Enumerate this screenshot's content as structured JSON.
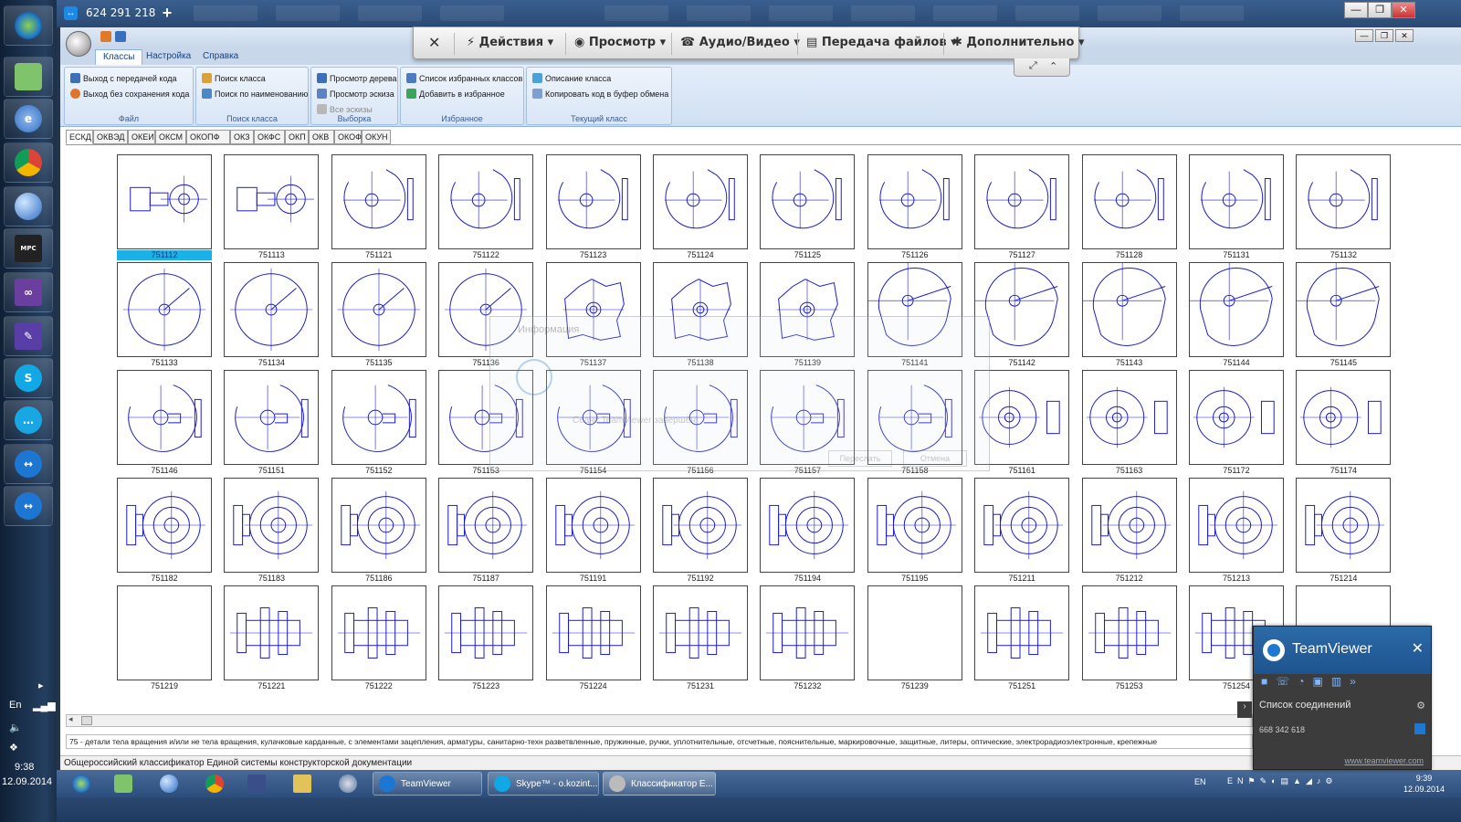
{
  "remote_bar": {
    "session_id": "624 291 218",
    "plus": "+"
  },
  "window_buttons": {
    "min": "—",
    "max": "❐",
    "close": "✕"
  },
  "ribbon": {
    "tabs": [
      "Классы",
      "Настройка",
      "Справка"
    ],
    "groups": {
      "file": {
        "label": "Файл",
        "exit_with_code": "Выход с передачей кода",
        "exit_no_save": "Выход без сохранения кода"
      },
      "search": {
        "label": "Поиск класса",
        "find_class": "Поиск класса",
        "find_by_name": "Поиск по наименованию"
      },
      "select": {
        "label": "Выборка",
        "tree_view": "Просмотр дерева",
        "sketch_view": "Просмотр эскиза",
        "all_sketches": "Все эскизы"
      },
      "favorites": {
        "label": "Избранное",
        "fav_list": "Список избранных классов",
        "add_fav": "Добавить в избранное"
      },
      "current": {
        "label": "Текущий класс",
        "description": "Описание класса",
        "copy_code": "Копировать код в буфер обмена"
      }
    }
  },
  "tv_toolbar": {
    "close": "✕",
    "actions": "Действия",
    "view": "Просмотр",
    "audio_video": "Аудио/Видео",
    "file_transfer": "Передача файлов",
    "extras": "Дополнительно",
    "fullscreen": "⤢",
    "collapse": "⌃"
  },
  "classifier_tabs": [
    "ЕСКД",
    "ОКВЭД",
    "ОКЕИ",
    "ОКСМ",
    "ОКОПФ",
    "ОКЗ",
    "ОКФС",
    "ОКП",
    "ОКВ",
    "ОКОФ",
    "ОКУН"
  ],
  "sketches": [
    "751112",
    "751113",
    "751121",
    "751122",
    "751123",
    "751124",
    "751125",
    "751126",
    "751127",
    "751128",
    "751131",
    "751132",
    "751133",
    "751134",
    "751135",
    "751136",
    "751137",
    "751138",
    "751139",
    "751141",
    "751142",
    "751143",
    "751144",
    "751145",
    "751146",
    "751151",
    "751152",
    "751153",
    "751154",
    "751156",
    "751157",
    "751158",
    "751161",
    "751163",
    "751172",
    "751174",
    "751182",
    "751183",
    "751186",
    "751187",
    "751191",
    "751192",
    "751194",
    "751195",
    "751211",
    "751212",
    "751213",
    "751214",
    "751219",
    "751221",
    "751222",
    "751223",
    "751224",
    "751231",
    "751232",
    "751239",
    "751251",
    "751253",
    "751254",
    ""
  ],
  "selected_sketch": "751112",
  "ghost_dialog": {
    "title": "Информация",
    "message": "Сеанс TeamViewer завершён",
    "ok": "Переслать",
    "cancel": "Отмена"
  },
  "info_text": "75 - детали тела вращения и/или не тела вращения, кулачковые карданные, с элементами зацепления, арматуры, санитарно-техн разветвленные, пружинные, ручки, уплотнительные, отсчетные, пояснительные, маркировочные, защитные, литеры, оптические, электрорадиоэлектронные, крепежные",
  "status_text": "Общероссийский классификатор Единой системы конструкторской документации",
  "teamviewer_panel": {
    "title": "TeamViewer",
    "close": "✕",
    "list_label": "Список соединений",
    "partner_id": "668 342 618",
    "url": "www.teamviewer.com"
  },
  "taskbar": {
    "tasks": [
      "TeamViewer",
      "Skype™ - o.kozint...",
      "Классификатор Е..."
    ],
    "lang": "EN",
    "time": "9:39",
    "date": "12.09.2014"
  },
  "host_tray": {
    "lang": "En",
    "time": "9:38",
    "date": "12.09.2014"
  }
}
